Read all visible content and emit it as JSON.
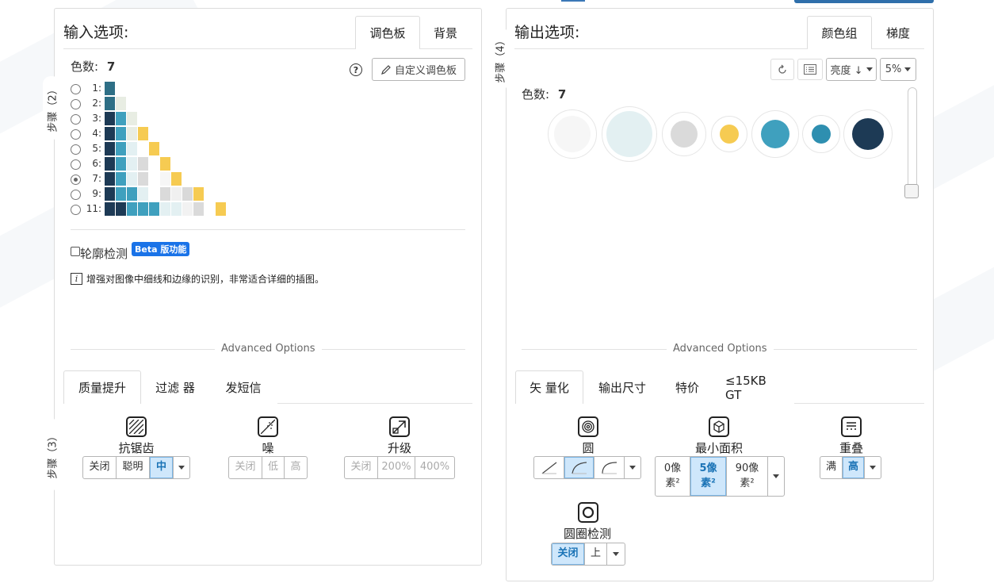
{
  "left": {
    "step_label": "步骤（2）",
    "step3_label": "步骤（3）",
    "title": "输入选项:",
    "tabs": [
      {
        "label": "调色板"
      },
      {
        "label": "背景"
      }
    ],
    "color_count_label": "色数:",
    "color_count_value": "7",
    "help_icon": "question-circle-icon",
    "custom_palette_label": "自定义调色板",
    "palette_rows": [
      {
        "label": "1:",
        "colors": [
          "#2e6f86"
        ]
      },
      {
        "label": "2:",
        "colors": [
          "#2e6f86",
          "#e8ede3"
        ]
      },
      {
        "label": "3:",
        "colors": [
          "#1d3a55",
          "#3fa0be",
          "#e8ede3"
        ]
      },
      {
        "label": "4:",
        "colors": [
          "#1d3a55",
          "#3fa0be",
          "#e8ede3",
          "#f6cb52"
        ]
      },
      {
        "label": "5:",
        "colors": [
          "#1d3a55",
          "#3fa0be",
          "#e3f0f2",
          "#ffffff",
          "#f6cb52"
        ]
      },
      {
        "label": "6:",
        "colors": [
          "#1d3a55",
          "#3fa0be",
          "#e3f0f2",
          "#dadada",
          "#ffffff",
          "#f6cb52"
        ]
      },
      {
        "label": "7:",
        "colors": [
          "#1d3a55",
          "#3fa0be",
          "#e3f0f2",
          "#dadada",
          "#ffffff",
          "#f6f6f6",
          "#f6cb52"
        ]
      },
      {
        "label": "9:",
        "colors": [
          "#1d3a55",
          "#3fa0be",
          "#3fa0be",
          "#e3f0f2",
          "#ffffff",
          "#dadada",
          "#f0f0f0",
          "#d9d9d9",
          "#f6cb52"
        ]
      },
      {
        "label": "11:",
        "colors": [
          "#1d3a55",
          "#1d3a55",
          "#3fa0be",
          "#3fa0be",
          "#3fa0be",
          "#e3f0f2",
          "#e3f0f2",
          "#f2f2f2",
          "#dadada",
          "#ffffff",
          "#f6cb52"
        ]
      }
    ],
    "selected_row": 6,
    "contour_label": "轮廓检测",
    "beta_label": "Beta 版功能",
    "info_text": "增强对图像中细线和边缘的识别，非常适合详细的插图。",
    "advanced_label": "Advanced Options",
    "lower_tabs": [
      {
        "label": "质量提升"
      },
      {
        "label": "过滤 器"
      },
      {
        "label": "发短信"
      }
    ],
    "options": [
      {
        "label": "抗锯齿",
        "icon": "antialias-icon",
        "segments": [
          "关闭",
          "聪明",
          "中"
        ],
        "active": 2,
        "disabled": false,
        "dropdown": true
      },
      {
        "label": "噪",
        "icon": "noise-icon",
        "segments": [
          "关闭",
          "低",
          "高"
        ],
        "active": -1,
        "disabled": true,
        "dropdown": false
      },
      {
        "label": "升级",
        "icon": "upscale-icon",
        "segments": [
          "关闭",
          "200%",
          "400%"
        ],
        "active": -1,
        "disabled": true,
        "dropdown": false
      }
    ]
  },
  "right": {
    "step_label": "步骤（4）",
    "title": "输出选项:",
    "tabs": [
      {
        "label": "颜色组"
      },
      {
        "label": "梯度"
      }
    ],
    "sort_label": "亮度 ↓",
    "percent_label": "5%",
    "color_count_label": "色数:",
    "color_count_value": "7",
    "colors": [
      "#f6f6f6",
      "#e3f0f2",
      "#dadada",
      "#f6cb52",
      "#3fa0be",
      "#2e8fb0",
      "#1d3a55"
    ],
    "advanced_label": "Advanced Options",
    "lower_tabs": [
      {
        "label": "矢 量化"
      },
      {
        "label": "输出尺寸"
      },
      {
        "label": "特价"
      },
      {
        "label": "≤15KB GT"
      }
    ],
    "circle_label": "圆",
    "min_area_label": "最小面积",
    "min_area_segments": [
      "0像素²",
      "5像素²",
      "90像素²"
    ],
    "overlap_label": "重叠",
    "overlap_segments": [
      "满",
      "高"
    ],
    "ring_label": "圆圈检测",
    "ring_segments": [
      "关闭",
      "上"
    ]
  }
}
